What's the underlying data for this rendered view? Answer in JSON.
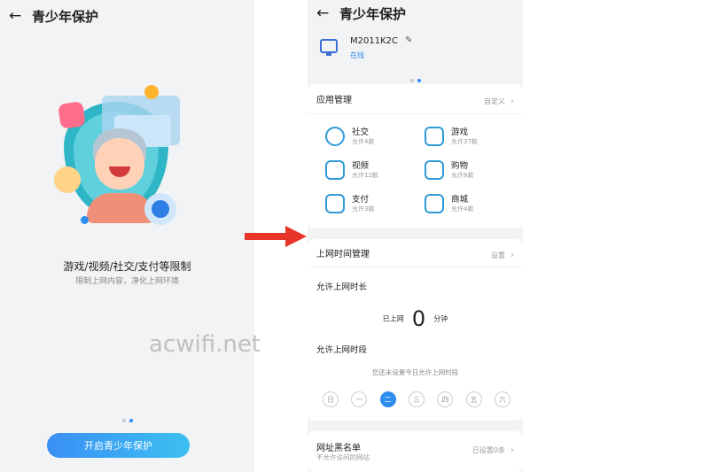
{
  "left": {
    "back_icon": "←",
    "title": "青少年保护",
    "headline": "游戏/视频/社交/支付等限制",
    "subtitle": "限制上网内容，净化上网环境",
    "primary_button": "开启青少年保护"
  },
  "right": {
    "back_icon": "←",
    "title": "青少年保护",
    "device": {
      "name": "M2011K2C",
      "status": "在线"
    },
    "app_management": {
      "title": "应用管理",
      "action": "自定义",
      "items": [
        {
          "name": "社交",
          "sub": "允许4款",
          "icon": "chat-icon"
        },
        {
          "name": "游戏",
          "sub": "允许37款",
          "icon": "gamepad-icon"
        },
        {
          "name": "视频",
          "sub": "允许12款",
          "icon": "video-icon"
        },
        {
          "name": "购物",
          "sub": "允许8款",
          "icon": "shopping-bag-icon"
        },
        {
          "name": "支付",
          "sub": "允许3款",
          "icon": "card-icon"
        },
        {
          "name": "商城",
          "sub": "允许4款",
          "icon": "store-icon"
        }
      ]
    },
    "time_management": {
      "title": "上网时间管理",
      "action": "设置",
      "duration_label": "允许上网时长",
      "used_prefix": "已上网",
      "used_value": "0",
      "used_unit": "分钟",
      "period_label": "允许上网时段",
      "not_set": "您还未设置今日允许上网时段",
      "weekdays": [
        "日",
        "一",
        "二",
        "三",
        "四",
        "五",
        "六"
      ],
      "active_weekday": "二"
    },
    "blacklist": {
      "title": "网址黑名单",
      "subtitle": "不允许访问的网站",
      "status": "已设置0条"
    }
  },
  "watermark": "acwifi.net",
  "colors": {
    "accent": "#2f8df0",
    "arrow": "#e8352a"
  }
}
